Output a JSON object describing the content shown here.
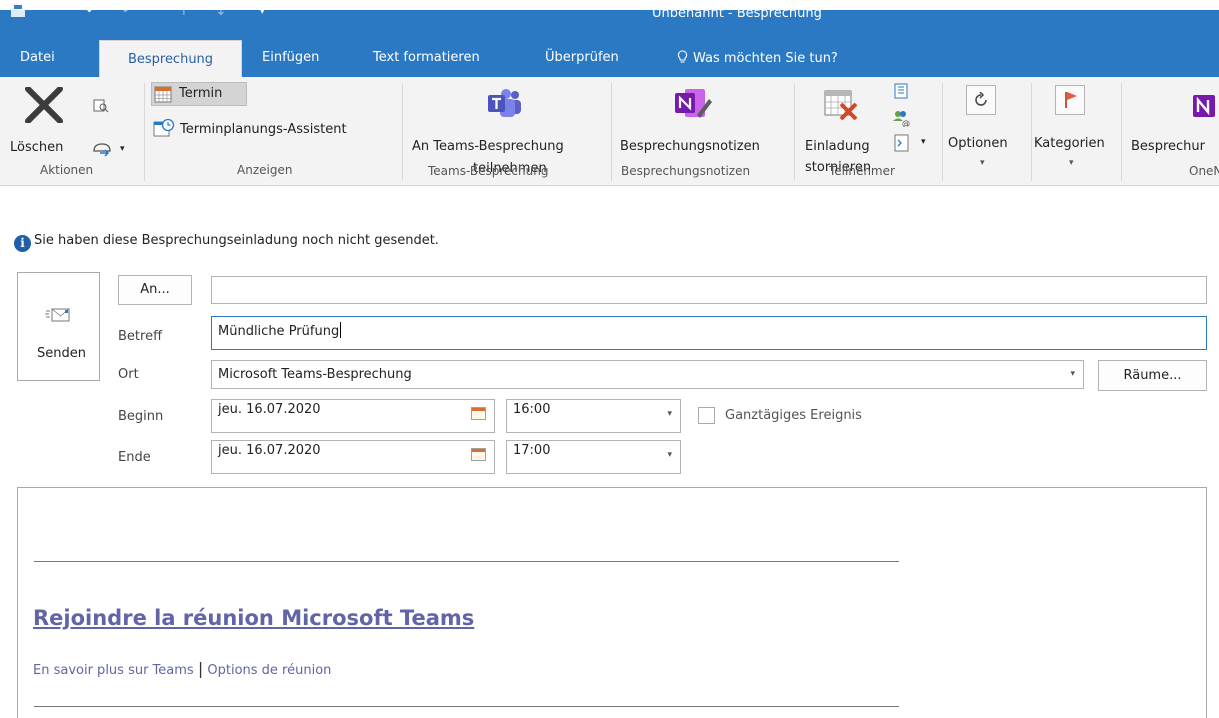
{
  "window": {
    "title": "Unbenannt - Besprechung"
  },
  "tabs": [
    {
      "label": "Datei"
    },
    {
      "label": "Besprechung"
    },
    {
      "label": "Einfügen"
    },
    {
      "label": "Text formatieren"
    },
    {
      "label": "Überprüfen"
    },
    {
      "label": "Was möchten Sie tun?"
    }
  ],
  "ribbon": {
    "aktionen": {
      "delete_label": "Löschen",
      "group": "Aktionen"
    },
    "anzeigen": {
      "termin": "Termin",
      "assistent": "Terminplanungs-Assistent",
      "group": "Anzeigen"
    },
    "teams": {
      "line1": "An Teams-Besprechung",
      "line2": "teilnehmen",
      "group": "Teams-Besprechung"
    },
    "notizen": {
      "label": "Besprechungsnotizen",
      "group": "Besprechungsnotizen"
    },
    "teilnehmer": {
      "line1": "Einladung",
      "line2": "stornieren",
      "group": "Teilnehmer"
    },
    "optionen": {
      "label": "Optionen"
    },
    "kategorien": {
      "label": "Kategorien"
    },
    "onenote": {
      "label": "Besprechur",
      "group": "OneN"
    }
  },
  "info": {
    "text": "Sie haben diese Besprechungseinladung noch nicht gesendet."
  },
  "form": {
    "send_label": "Senden",
    "to_button": "An...",
    "to_value": "",
    "subject_label": "Betreff",
    "subject_value": "Mündliche Prüfung",
    "location_label": "Ort",
    "location_value": "Microsoft Teams-Besprechung",
    "rooms_button": "Räume...",
    "start_label": "Beginn",
    "start_date": "jeu. 16.07.2020",
    "start_time": "16:00",
    "allday_label": "Ganztägiges Ereignis",
    "end_label": "Ende",
    "end_date": "jeu. 16.07.2020",
    "end_time": "17:00"
  },
  "body": {
    "join_link": "Rejoindre la réunion Microsoft Teams",
    "learn_more": "En savoir plus sur Teams",
    "divider": "|",
    "meeting_options": "Options de réunion"
  },
  "colors": {
    "title_bar": "#2b79c2",
    "ribbon_bg": "#f3f3f3",
    "teams_purple": "#5b5fc7",
    "onenote_purple": "#7719aa",
    "link": "#6264a7"
  }
}
